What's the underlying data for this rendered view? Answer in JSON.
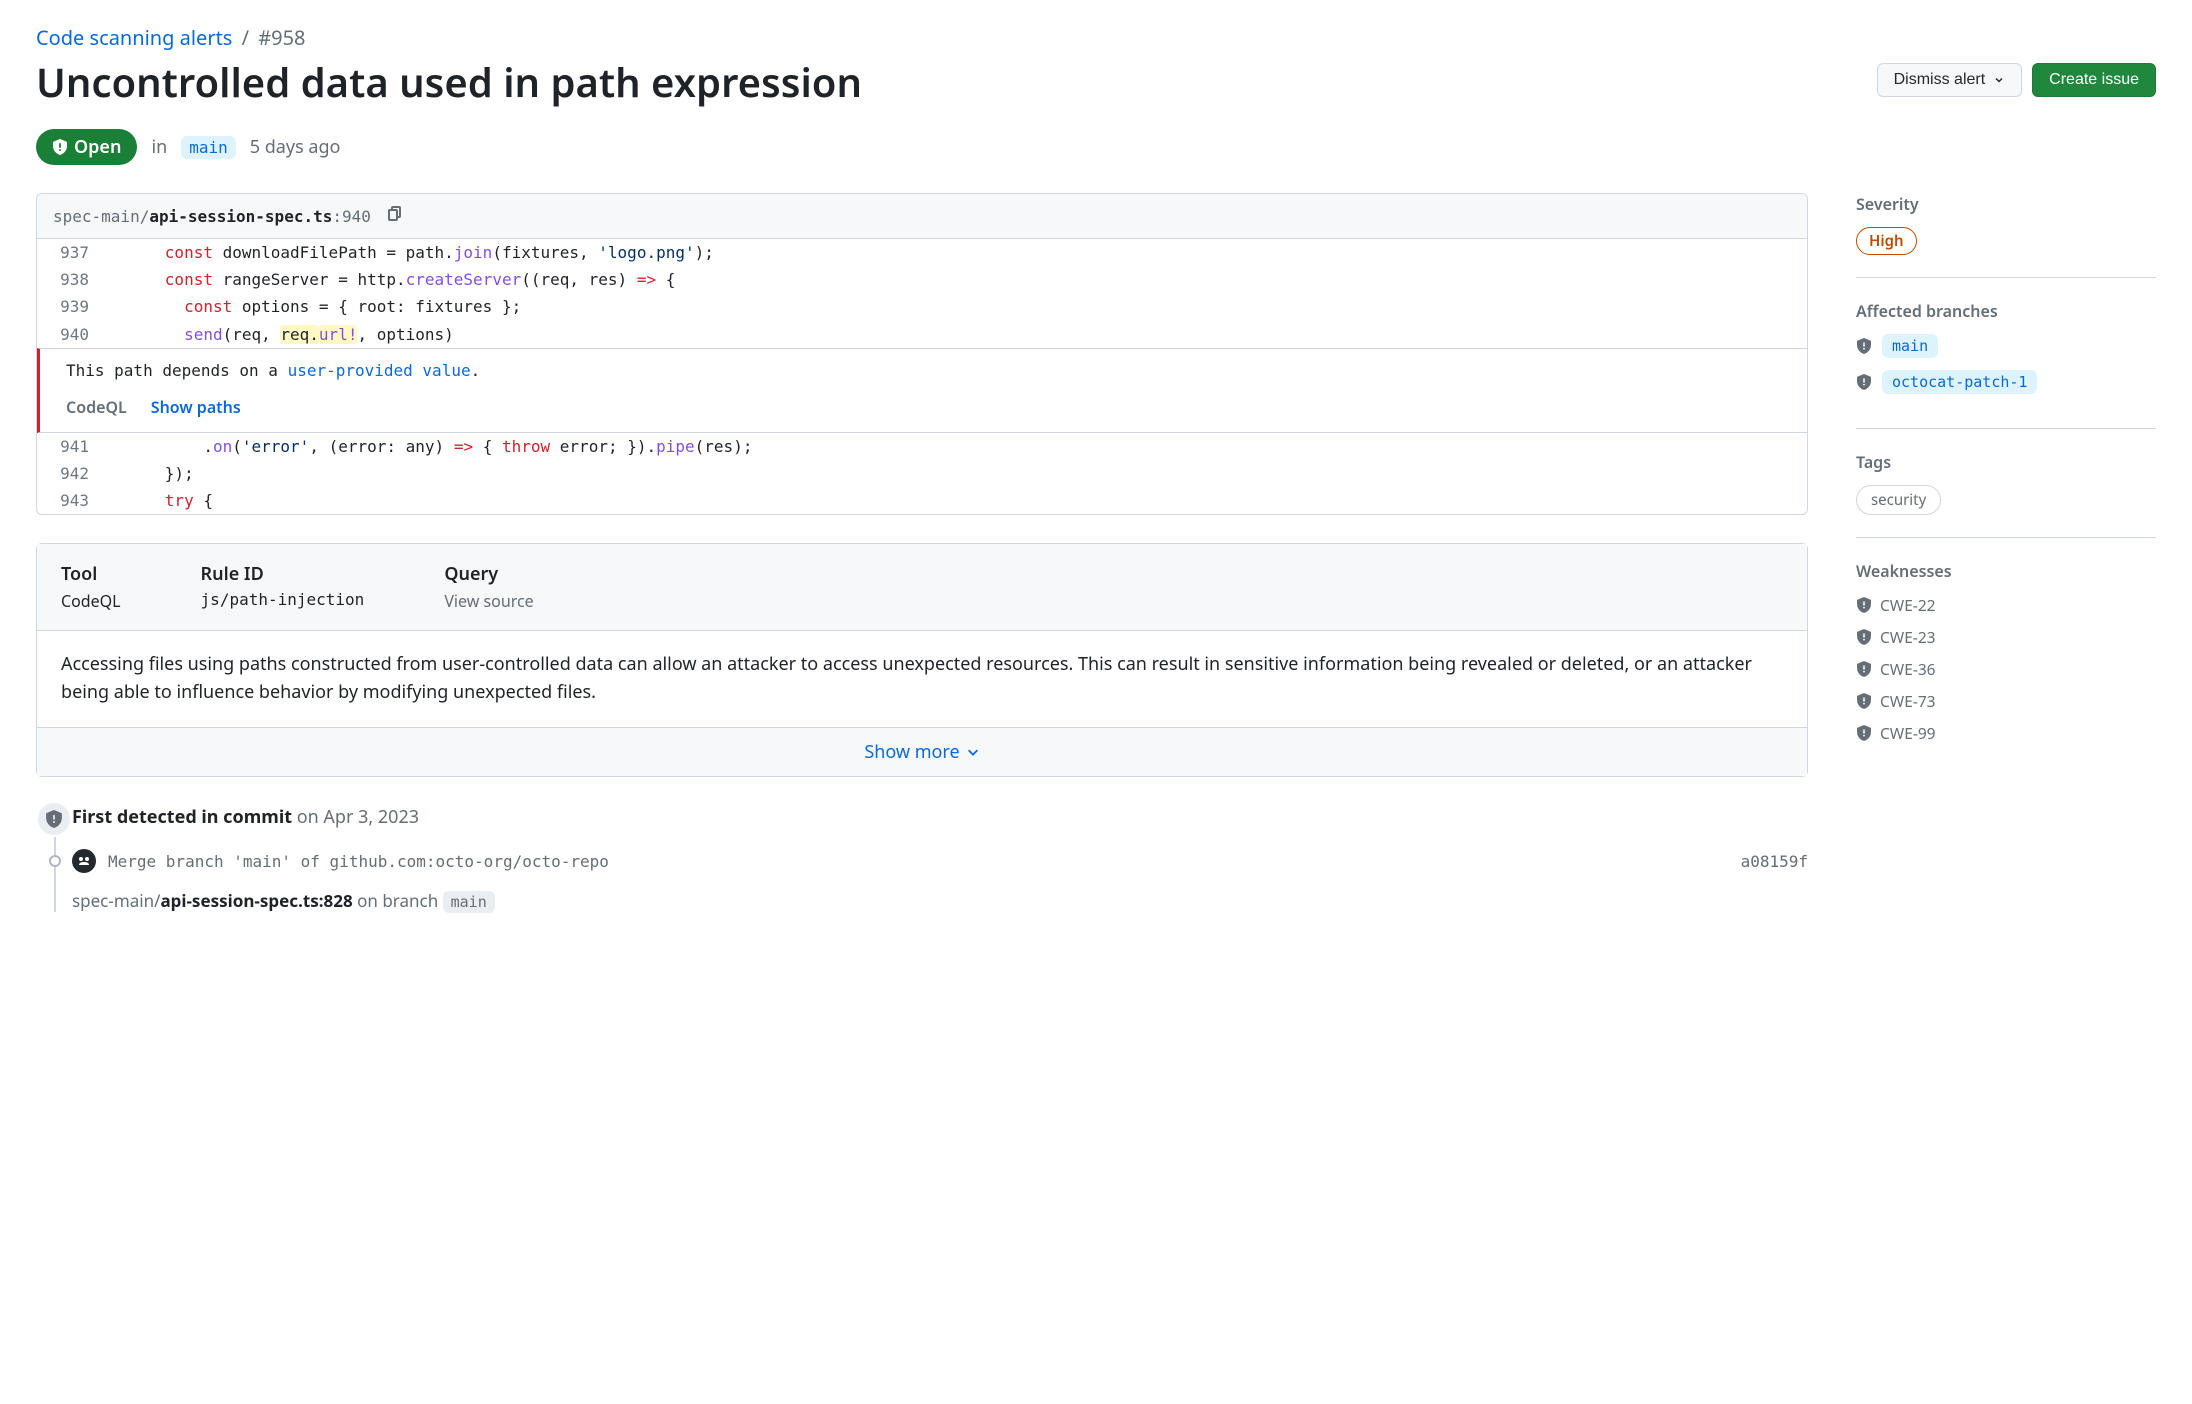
{
  "breadcrumb": {
    "parent": "Code scanning alerts",
    "current": "#958"
  },
  "title": "Uncontrolled data used in path expression",
  "actions": {
    "dismiss": "Dismiss alert",
    "create_issue": "Create issue"
  },
  "status": {
    "state": "Open",
    "in_word": "in",
    "branch": "main",
    "age": "5 days ago"
  },
  "file": {
    "path_dir": "spec-main/",
    "path_file": "api-session-spec.ts",
    "focus_line": ":940"
  },
  "code": {
    "lines_before": [
      {
        "n": "937",
        "indent": "      ",
        "tokens": [
          {
            "t": "const ",
            "c": "kw"
          },
          {
            "t": "downloadFilePath = path."
          },
          {
            "t": "join",
            "c": "fn"
          },
          {
            "t": "(fixtures, "
          },
          {
            "t": "'logo.png'",
            "c": "str"
          },
          {
            "t": ");"
          }
        ]
      },
      {
        "n": "938",
        "indent": "      ",
        "tokens": [
          {
            "t": "const ",
            "c": "kw"
          },
          {
            "t": "rangeServer = http."
          },
          {
            "t": "createServer",
            "c": "fn"
          },
          {
            "t": "((req, res) "
          },
          {
            "t": "=>",
            "c": "op"
          },
          {
            "t": " {"
          }
        ]
      },
      {
        "n": "939",
        "indent": "        ",
        "tokens": [
          {
            "t": "const ",
            "c": "kw"
          },
          {
            "t": "options = { root: fixtures };"
          }
        ]
      },
      {
        "n": "940",
        "indent": "        ",
        "tokens": [
          {
            "t": "send",
            "c": "fn"
          },
          {
            "t": "(req, "
          },
          {
            "t": "req.",
            "c": "hl"
          },
          {
            "t": "url!",
            "c": "hl fn"
          },
          {
            "t": ", options)"
          }
        ]
      }
    ],
    "lines_after": [
      {
        "n": "941",
        "indent": "          ",
        "tokens": [
          {
            "t": "."
          },
          {
            "t": "on",
            "c": "fn"
          },
          {
            "t": "("
          },
          {
            "t": "'error'",
            "c": "str"
          },
          {
            "t": ", (error: any) "
          },
          {
            "t": "=>",
            "c": "op"
          },
          {
            "t": " { "
          },
          {
            "t": "throw",
            "c": "kw"
          },
          {
            "t": " error; })."
          },
          {
            "t": "pipe",
            "c": "fn"
          },
          {
            "t": "(res);"
          }
        ]
      },
      {
        "n": "942",
        "indent": "      ",
        "tokens": [
          {
            "t": "});"
          }
        ]
      },
      {
        "n": "943",
        "indent": "      ",
        "tokens": [
          {
            "t": "try",
            "c": "kw"
          },
          {
            "t": " {"
          }
        ]
      }
    ]
  },
  "annotation": {
    "pre": "This path depends on a ",
    "link": "user-provided value",
    "post": ".",
    "tool_label": "CodeQL",
    "show_paths": "Show paths"
  },
  "rule": {
    "tool_h": "Tool",
    "tool_v": "CodeQL",
    "ruleid_h": "Rule ID",
    "ruleid_v": "js/path-injection",
    "query_h": "Query",
    "query_v": "View source",
    "description": "Accessing files using paths constructed from user-controlled data can allow an attacker to access unexpected resources. This can result in sensitive information being revealed or deleted, or an attacker being able to influence behavior by modifying unexpected files.",
    "show_more": "Show more"
  },
  "timeline": {
    "first_detected_bold": "First detected in commit",
    "first_detected_rest": " on Apr 3, 2023",
    "commit_message": "Merge branch 'main' of github.com:octo-org/octo-repo",
    "commit_sha": "a08159f",
    "file_path_dir": "spec-main/",
    "file_path_file": "api-session-spec.ts:828",
    "on_branch_text": " on branch ",
    "on_branch": "main"
  },
  "sidebar": {
    "severity_h": "Severity",
    "severity_v": "High",
    "branches_h": "Affected branches",
    "branches": [
      "main",
      "octocat-patch-1"
    ],
    "tags_h": "Tags",
    "tags": [
      "security"
    ],
    "weaknesses_h": "Weaknesses",
    "weaknesses": [
      "CWE-22",
      "CWE-23",
      "CWE-36",
      "CWE-73",
      "CWE-99"
    ]
  }
}
